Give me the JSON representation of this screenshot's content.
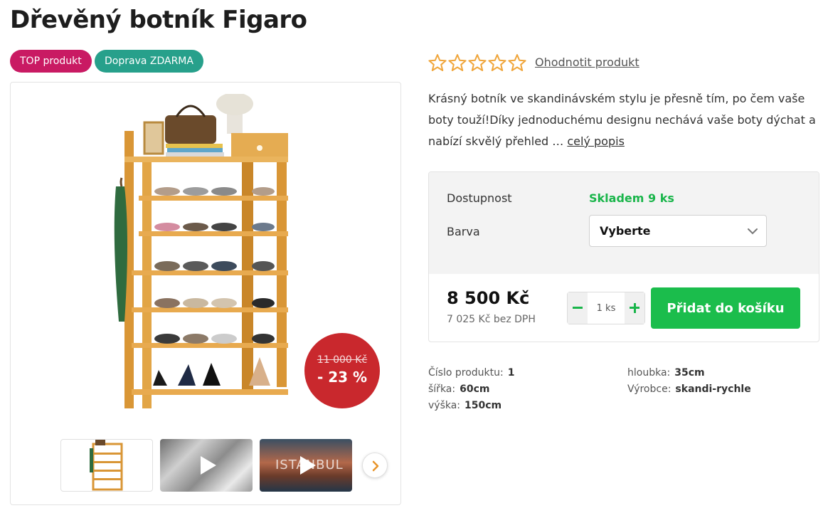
{
  "product": {
    "title": "Dřevěný botník Figaro",
    "badges": [
      "TOP produkt",
      "Doprava ZDARMA"
    ]
  },
  "colors": {
    "badge_top": "#c91a63",
    "badge_shipping": "#27a08b",
    "discount": "#c9282d",
    "available": "#19b54a",
    "add_to_cart": "#1bbd4c",
    "star_outline": "#f0a53a"
  },
  "rating": {
    "stars_filled": 0,
    "stars_total": 5,
    "link": "Ohodnotit produkt"
  },
  "description": {
    "text": "Krásný botník ve skandinávském stylu je přesně tím, po čem vaše boty touží!Díky jednoduchému designu nechává vaše boty dýchat a nabízí skvělý přehled … ",
    "more_link": "celý popis"
  },
  "gallery": {
    "discount_old_price": "11 000 Kč",
    "discount_percent": "- 23 %",
    "thumb_caption": "ISTANBUL",
    "icons": [
      "play-icon",
      "chevron-right-icon"
    ]
  },
  "buybox": {
    "availability_label": "Dostupnost",
    "availability_value": "Skladem 9 ks",
    "color_label": "Barva",
    "color_select_value": "Vyberte",
    "price": "8 500 Kč",
    "price_without_vat": "7 025 Kč bez DPH",
    "quantity_value": "1",
    "quantity_unit": "ks",
    "add_to_cart_label": "Přidat do košíku"
  },
  "specs": {
    "left": [
      {
        "key": "Číslo produktu:",
        "value": "1"
      },
      {
        "key": "šířka:",
        "value": "60cm"
      },
      {
        "key": "výška:",
        "value": "150cm"
      }
    ],
    "right": [
      {
        "key": "hloubka:",
        "value": "35cm"
      },
      {
        "key": "Výrobce:",
        "value": "skandi-rychle"
      }
    ]
  }
}
